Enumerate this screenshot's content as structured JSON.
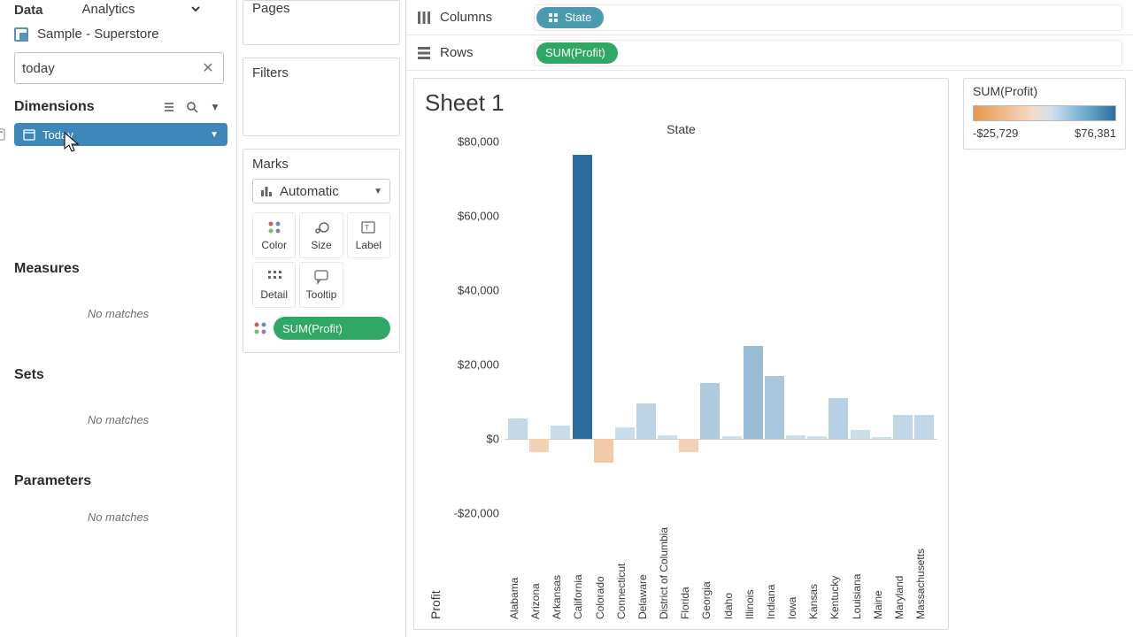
{
  "tabs": {
    "data": "Data",
    "analytics": "Analytics"
  },
  "datasource": "Sample - Superstore",
  "search": {
    "value": "today"
  },
  "sections": {
    "dimensions": "Dimensions",
    "measures": "Measures",
    "sets": "Sets",
    "parameters": "Parameters",
    "no_matches": "No matches"
  },
  "dim_field": "Today",
  "cards": {
    "pages": "Pages",
    "filters": "Filters",
    "marks": "Marks"
  },
  "marks": {
    "type": "Automatic",
    "color": "Color",
    "size": "Size",
    "label": "Label",
    "detail": "Detail",
    "tooltip": "Tooltip",
    "pill": "SUM(Profit)"
  },
  "shelves": {
    "columns_label": "Columns",
    "rows_label": "Rows",
    "columns_pill": "State",
    "rows_pill": "SUM(Profit)"
  },
  "sheet": {
    "title": "Sheet 1",
    "axis_top": "State",
    "axis_left": "Profit"
  },
  "legend": {
    "title": "SUM(Profit)",
    "min": "-$25,729",
    "max": "$76,381"
  },
  "chart_data": {
    "type": "bar",
    "ylabel": "Profit",
    "title": "State",
    "ylim": [
      -20000,
      80000
    ],
    "yticks": [
      -20000,
      0,
      20000,
      40000,
      60000,
      80000
    ],
    "ytick_labels": [
      "-$20,000",
      "$0",
      "$20,000",
      "$40,000",
      "$60,000",
      "$80,000"
    ],
    "color_domain": [
      -25729,
      76381
    ],
    "categories": [
      "Alabama",
      "Arizona",
      "Arkansas",
      "California",
      "Colorado",
      "Connecticut",
      "Delaware",
      "District of Columbia",
      "Florida",
      "Georgia",
      "Idaho",
      "Illinois",
      "Indiana",
      "Iowa",
      "Kansas",
      "Kentucky",
      "Louisiana",
      "Maine",
      "Maryland",
      "Massachusetts"
    ],
    "values": [
      5500,
      -3500,
      3500,
      76381,
      -6500,
      3000,
      9500,
      1000,
      -3500,
      15000,
      800,
      25000,
      17000,
      1000,
      800,
      11000,
      2500,
      400,
      6500,
      6500
    ]
  }
}
